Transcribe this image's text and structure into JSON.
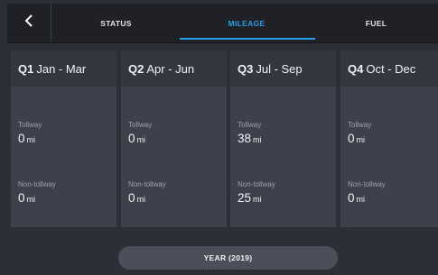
{
  "nav": {
    "back_icon": "chevron-left-icon",
    "tabs": [
      "STATUS",
      "MILEAGE",
      "FUEL"
    ],
    "active_tab": "MILEAGE",
    "active_color": "#2a9de8"
  },
  "quarters": [
    {
      "q": "Q1",
      "range": "Jan - Mar",
      "tollway_label": "Tollway",
      "tollway_value": "0",
      "tollway_unit": "mi",
      "nontollway_label": "Non-tollway",
      "nontollway_value": "0",
      "nontollway_unit": "mi"
    },
    {
      "q": "Q2",
      "range": "Apr - Jun",
      "tollway_label": "Tollway",
      "tollway_value": "0",
      "tollway_unit": "mi",
      "nontollway_label": "Non-tollway",
      "nontollway_value": "0",
      "nontollway_unit": "mi"
    },
    {
      "q": "Q3",
      "range": "Jul - Sep",
      "tollway_label": "Tollway",
      "tollway_value": "38",
      "tollway_unit": "mi",
      "nontollway_label": "Non-tollway",
      "nontollway_value": "25",
      "nontollway_unit": "mi"
    },
    {
      "q": "Q4",
      "range": "Oct - Dec",
      "tollway_label": "Tollway",
      "tollway_value": "0",
      "tollway_unit": "mi",
      "nontollway_label": "Non-tollway",
      "nontollway_value": "0",
      "nontollway_unit": "mi"
    }
  ],
  "footer": {
    "year_button_label": "YEAR (2019)"
  }
}
